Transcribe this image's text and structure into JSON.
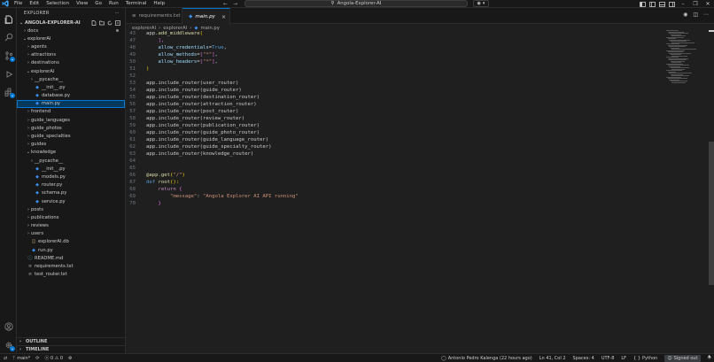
{
  "menu": [
    "File",
    "Edit",
    "Selection",
    "View",
    "Go",
    "Run",
    "Terminal",
    "Help"
  ],
  "command_center": {
    "text": "Angola-Explorer-AI"
  },
  "explorer": {
    "title": "EXPLORER",
    "root": "ANGOLA-EXPLORER-AI",
    "items": [
      {
        "label": "docs",
        "kind": "folder",
        "depth": 1,
        "open": false
      },
      {
        "label": "explorerAI",
        "kind": "folder",
        "depth": 1,
        "open": true
      },
      {
        "label": "agents",
        "kind": "folder",
        "depth": 2,
        "open": false
      },
      {
        "label": "attractions",
        "kind": "folder",
        "depth": 2,
        "open": false
      },
      {
        "label": "destinations",
        "kind": "folder",
        "depth": 2,
        "open": false
      },
      {
        "label": "explorerAI",
        "kind": "folder",
        "depth": 2,
        "open": true
      },
      {
        "label": "__pycache__",
        "kind": "folder",
        "depth": 3,
        "open": false
      },
      {
        "label": "__init__.py",
        "kind": "py",
        "depth": 3
      },
      {
        "label": "database.py",
        "kind": "py",
        "depth": 3
      },
      {
        "label": "main.py",
        "kind": "py",
        "depth": 3,
        "selected": true
      },
      {
        "label": "frontend",
        "kind": "folder",
        "depth": 2,
        "open": false
      },
      {
        "label": "guide_languages",
        "kind": "folder",
        "depth": 2,
        "open": false
      },
      {
        "label": "guide_photos",
        "kind": "folder",
        "depth": 2,
        "open": false
      },
      {
        "label": "guide_specialties",
        "kind": "folder",
        "depth": 2,
        "open": false
      },
      {
        "label": "guides",
        "kind": "folder",
        "depth": 2,
        "open": false
      },
      {
        "label": "knowledge",
        "kind": "folder",
        "depth": 2,
        "open": true
      },
      {
        "label": "__pycache__",
        "kind": "folder",
        "depth": 3,
        "open": false
      },
      {
        "label": "__init__.py",
        "kind": "py",
        "depth": 3
      },
      {
        "label": "models.py",
        "kind": "py",
        "depth": 3
      },
      {
        "label": "router.py",
        "kind": "py",
        "depth": 3
      },
      {
        "label": "schema.py",
        "kind": "py",
        "depth": 3
      },
      {
        "label": "service.py",
        "kind": "py",
        "depth": 3
      },
      {
        "label": "posts",
        "kind": "folder",
        "depth": 2,
        "open": false
      },
      {
        "label": "publications",
        "kind": "folder",
        "depth": 2,
        "open": false
      },
      {
        "label": "reviews",
        "kind": "folder",
        "depth": 2,
        "open": false
      },
      {
        "label": "users",
        "kind": "folder",
        "depth": 2,
        "open": false
      },
      {
        "label": "explorerAI.db",
        "kind": "db",
        "depth": 2
      },
      {
        "label": "run.py",
        "kind": "py",
        "depth": 2
      },
      {
        "label": "README.md",
        "kind": "md",
        "depth": 1
      },
      {
        "label": "requirements.txt",
        "kind": "txt",
        "depth": 1
      },
      {
        "label": "test_router.txt",
        "kind": "txt",
        "depth": 1
      }
    ],
    "outline": "OUTLINE",
    "timeline": "TIMELINE"
  },
  "tabs": [
    {
      "label": "requirements.txt",
      "active": false
    },
    {
      "label": "main.py",
      "active": true
    }
  ],
  "breadcrumb": [
    "explorerAI",
    "explorerAI",
    "main.py"
  ],
  "code_lines": [
    {
      "n": "43",
      "tokens": [
        [
          "app",
          "lt"
        ],
        [
          ".",
          "t-pun"
        ],
        [
          "add_middleware",
          "t-fn"
        ],
        [
          "(",
          "t-br"
        ]
      ]
    },
    {
      "n": "47",
      "tokens": [
        [
          "    ],",
          "t-br2"
        ]
      ]
    },
    {
      "n": "48",
      "tokens": [
        [
          "    ",
          "lt"
        ],
        [
          "allow_credentials",
          "t-var"
        ],
        [
          "=",
          "t-pun"
        ],
        [
          "True",
          "t-def"
        ],
        [
          ",",
          "t-pun"
        ]
      ]
    },
    {
      "n": "49",
      "tokens": [
        [
          "    ",
          "lt"
        ],
        [
          "allow_methods",
          "t-var"
        ],
        [
          "=",
          "t-pun"
        ],
        [
          "[",
          "t-br2"
        ],
        [
          "\"*\"",
          "t-str"
        ],
        [
          "]",
          "t-br2"
        ],
        [
          ",",
          "t-pun"
        ]
      ]
    },
    {
      "n": "50",
      "tokens": [
        [
          "    ",
          "lt"
        ],
        [
          "allow_headers",
          "t-var"
        ],
        [
          "=",
          "t-pun"
        ],
        [
          "[",
          "t-br2"
        ],
        [
          "\"*\"",
          "t-str"
        ],
        [
          "]",
          "t-br2"
        ],
        [
          ",",
          "t-pun"
        ]
      ]
    },
    {
      "n": "51",
      "tokens": [
        [
          ")",
          "t-br"
        ]
      ]
    },
    {
      "n": "52",
      "tokens": []
    },
    {
      "n": "53",
      "tokens": [
        [
          "app.include_router(user_router)",
          "lt"
        ]
      ]
    },
    {
      "n": "54",
      "tokens": [
        [
          "app.include_router(guide_router)",
          "lt"
        ]
      ]
    },
    {
      "n": "55",
      "tokens": [
        [
          "app.include_router(destination_router)",
          "lt"
        ]
      ]
    },
    {
      "n": "56",
      "tokens": [
        [
          "app.include_router(attraction_router)",
          "lt"
        ]
      ]
    },
    {
      "n": "57",
      "tokens": [
        [
          "app.include_router(post_router)",
          "lt"
        ]
      ]
    },
    {
      "n": "58",
      "tokens": [
        [
          "app.include_router(review_router)",
          "lt"
        ]
      ]
    },
    {
      "n": "59",
      "tokens": [
        [
          "app.include_router(publication_router)",
          "lt"
        ]
      ]
    },
    {
      "n": "60",
      "tokens": [
        [
          "app.include_router(guide_photo_router)",
          "lt"
        ]
      ]
    },
    {
      "n": "61",
      "tokens": [
        [
          "app.include_router(guide_language_router)",
          "lt"
        ]
      ]
    },
    {
      "n": "62",
      "tokens": [
        [
          "app.include_router(guide_specialty_router)",
          "lt"
        ]
      ]
    },
    {
      "n": "63",
      "tokens": [
        [
          "app.include_router(knowledge_router)",
          "lt"
        ]
      ]
    },
    {
      "n": "64",
      "tokens": []
    },
    {
      "n": "65",
      "tokens": []
    },
    {
      "n": "66",
      "tokens": [
        [
          "@app.get",
          "t-dec"
        ],
        [
          "(",
          "t-br"
        ],
        [
          "\"/\"",
          "t-str"
        ],
        [
          ")",
          "t-br"
        ]
      ]
    },
    {
      "n": "67",
      "tokens": [
        [
          "def ",
          "t-def"
        ],
        [
          "root",
          "t-fn"
        ],
        [
          "():",
          "t-br"
        ]
      ]
    },
    {
      "n": "68",
      "tokens": [
        [
          "    ",
          "lt"
        ],
        [
          "return ",
          "t-kw"
        ],
        [
          "{",
          "t-br2"
        ]
      ]
    },
    {
      "n": "69",
      "tokens": [
        [
          "        ",
          "lt"
        ],
        [
          "\"message\"",
          "t-str"
        ],
        [
          ": ",
          "t-pun"
        ],
        [
          "\"Angola Explorer AI API running\"",
          "t-str"
        ]
      ]
    },
    {
      "n": "70",
      "tokens": [
        [
          "    ",
          "lt"
        ],
        [
          "}",
          "t-br2"
        ]
      ]
    }
  ],
  "status": {
    "branch": "main*",
    "problems": "ⓧ 0 ⚠ 0",
    "blame": "Antonio Pedro Kalenga (22 hours ago)",
    "position": "Ln 41, Col 2",
    "spaces": "Spaces: 4",
    "encoding": "UTF-8",
    "eol": "LF",
    "language": "Python",
    "signed_out": "Signed out"
  },
  "colors": {
    "accent": "#0078d4",
    "selection": "#04395e",
    "background": "#1f1f1f",
    "sidebar": "#181818"
  }
}
